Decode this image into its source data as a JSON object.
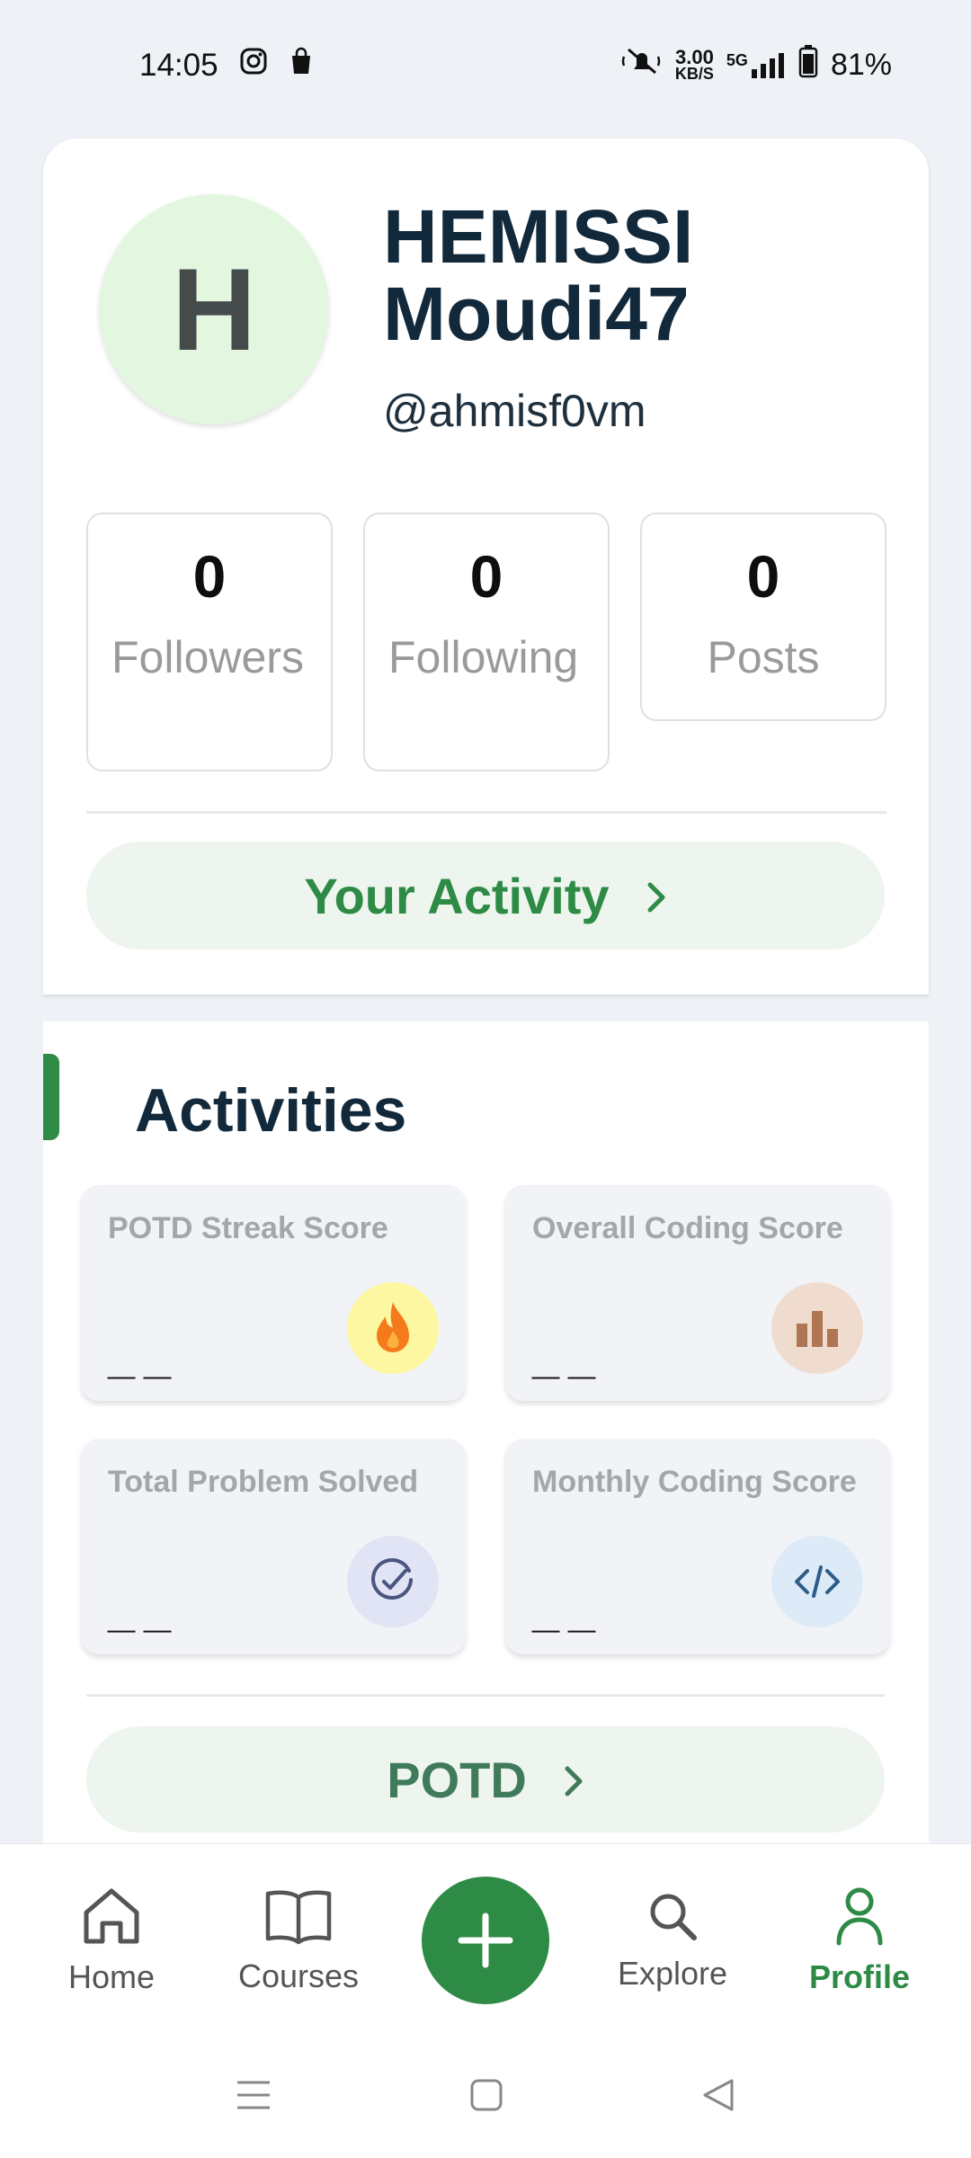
{
  "status_bar": {
    "time": "14:05",
    "net_speed_value": "3.00",
    "net_speed_unit": "KB/S",
    "network": "5G",
    "battery": "81%"
  },
  "profile": {
    "avatar_letter": "H",
    "name": "HEMISSI Moudi47",
    "handle": "@ahmisf0vm",
    "stats": [
      {
        "value": "0",
        "label": "Followers"
      },
      {
        "value": "0",
        "label": "Following"
      },
      {
        "value": "0",
        "label": "Posts"
      }
    ],
    "activity_button": "Your Activity"
  },
  "activities": {
    "title": "Activities",
    "tiles": [
      {
        "label": "POTD Streak Score",
        "value": "__",
        "icon": "flame-icon",
        "icon_bg": "#fcf7a0"
      },
      {
        "label": "Overall Coding Score",
        "value": "__",
        "icon": "bar-chart-icon",
        "icon_bg": "#f0dcce"
      },
      {
        "label": "Total Problem Solved",
        "value": "__",
        "icon": "check-circle-icon",
        "icon_bg": "#e0e4f5"
      },
      {
        "label": "Monthly Coding Score",
        "value": "__",
        "icon": "code-icon",
        "icon_bg": "#dcebf7"
      }
    ],
    "potd_button": "POTD"
  },
  "bottom_nav": {
    "items": [
      {
        "label": "Home",
        "icon": "home-icon"
      },
      {
        "label": "Courses",
        "icon": "book-icon"
      },
      {
        "label": "Explore",
        "icon": "search-icon"
      },
      {
        "label": "Profile",
        "icon": "person-icon"
      }
    ]
  },
  "colors": {
    "brand_green": "#2e8b45",
    "background": "#eef1f5"
  }
}
